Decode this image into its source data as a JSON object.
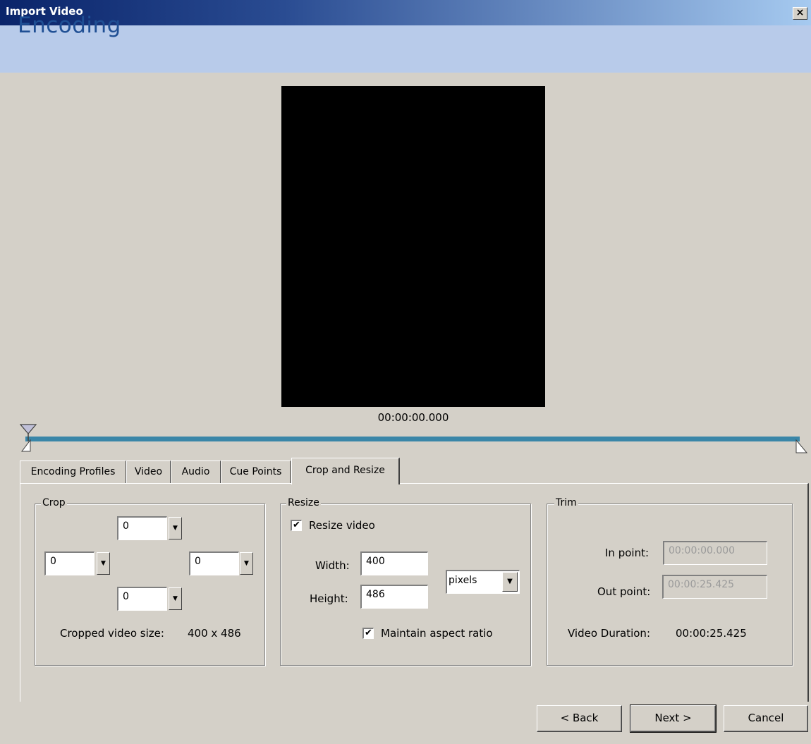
{
  "window": {
    "title": "Import Video",
    "close_glyph": "×"
  },
  "header": {
    "title": "Encoding"
  },
  "preview": {
    "timecode": "00:00:00.000"
  },
  "scrubber": {
    "position": 0.0
  },
  "tabs": [
    {
      "label": "Encoding Profiles",
      "active": false
    },
    {
      "label": "Video",
      "active": false
    },
    {
      "label": "Audio",
      "active": false
    },
    {
      "label": "Cue Points",
      "active": false
    },
    {
      "label": "Crop and Resize",
      "active": true
    }
  ],
  "crop": {
    "group_label": "Crop",
    "top": "0",
    "left": "0",
    "right": "0",
    "bottom": "0",
    "size_label": "Cropped video size:",
    "size_value": "400 x 486"
  },
  "resize": {
    "group_label": "Resize",
    "resize_label": "Resize video",
    "resize_checked": true,
    "width_label": "Width:",
    "width_value": "400",
    "height_label": "Height:",
    "height_value": "486",
    "unit_value": "pixels",
    "aspect_label": "Maintain aspect ratio",
    "aspect_checked": true,
    "check_glyph": "✔"
  },
  "trim": {
    "group_label": "Trim",
    "in_label": "In point:",
    "in_value": "00:00:00.000",
    "out_label": "Out point:",
    "out_value": "00:00:25.425",
    "duration_label": "Video Duration:",
    "duration_value": "00:00:25.425"
  },
  "buttons": {
    "back": "< Back",
    "next": "Next >",
    "cancel": "Cancel"
  },
  "colors": {
    "titlebar_start": "#0a246a",
    "header_band": "#b8cbea",
    "header_text": "#1f4f94",
    "track": "#3a86a8"
  }
}
